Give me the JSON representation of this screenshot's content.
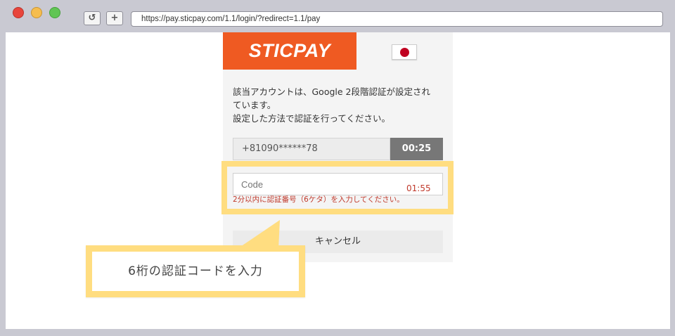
{
  "browser": {
    "reload_icon": "↺",
    "newtab_icon": "+",
    "url": "https://pay.sticpay.com/1.1/login/?redirect=1.1/pay"
  },
  "page": {
    "logo_text": "STICPAY",
    "language_flag": "japan-flag",
    "message_lines": [
      "該当アカウントは、Google 2段階認証が設定され",
      "ています。",
      "設定した方法で認証を行ってください。"
    ],
    "phone_masked": "+81090******78",
    "phone_timer": "00:25",
    "code_placeholder": "Code",
    "code_timer": "01:55",
    "code_hint": "2分以内に認証番号（6ケタ）を入力してください。",
    "cancel_label": "キャンセル"
  },
  "annotation": {
    "callout_text": "6桁の認証コードを入力",
    "highlight_color": "#ffdd80"
  },
  "colors": {
    "brand": "#ef5a22",
    "error": "#c0392b",
    "timer_bg": "#777777"
  }
}
